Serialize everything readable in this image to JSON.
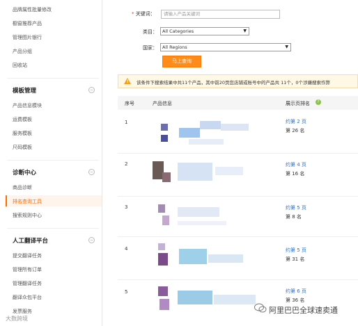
{
  "sidebar": {
    "top_items": [
      "品牌属性批量修改",
      "橱窗推荐产品",
      "管理图片银行",
      "产品分组",
      "回收站"
    ],
    "sections": [
      {
        "title": "模板管理",
        "toggle": "−",
        "items": [
          "产品信息模块",
          "运费模板",
          "服务模板",
          "尺码模板"
        ]
      },
      {
        "title": "诊断中心",
        "toggle": "−",
        "items": [
          "商品诊断",
          "排名查询工具",
          "搜索规则中心"
        ],
        "active": "排名查询工具"
      },
      {
        "title": "人工翻译平台",
        "toggle": "−",
        "items": [
          "提交翻译任务",
          "管理所有订单",
          "管理翻译任务",
          "翻译众包平台",
          "发票服务"
        ]
      }
    ]
  },
  "search_form": {
    "keyword_label": "关键词：",
    "keyword_required": "*",
    "keyword_placeholder": "请输入产品关键词",
    "category_label": "类目：",
    "category_value": "All Categories",
    "country_label": "国家：",
    "country_value": "All Regions",
    "submit_label": "马上查询"
  },
  "notice": {
    "text": "该条件下搜索结果中共11个产品，其中前20页您店铺或账号中的产品共 11个，0个涉嫌搜索作弊",
    "accent": "#f0a020"
  },
  "table": {
    "headers": {
      "index": "序号",
      "product": "产品信息",
      "rank": "展示页排名"
    },
    "help_icon": "?",
    "rows": [
      {
        "index": "1",
        "page": "约第 2 页",
        "position": "第 26 名"
      },
      {
        "index": "2",
        "page": "约第 4 页",
        "position": "第 16 名"
      },
      {
        "index": "3",
        "page": "约第 5 页",
        "position": "第 8 名"
      },
      {
        "index": "4",
        "page": "约第 5 页",
        "position": "第 31 名"
      },
      {
        "index": "5",
        "page": "约第 6 页",
        "position": "第 36 名"
      }
    ]
  },
  "watermark": {
    "main": "阿里巴巴全球速卖通",
    "corner": "大数跨境"
  },
  "colors": {
    "accent": "#ff6a00",
    "button": "#ff8c1a",
    "link": "#2b6fc2"
  }
}
